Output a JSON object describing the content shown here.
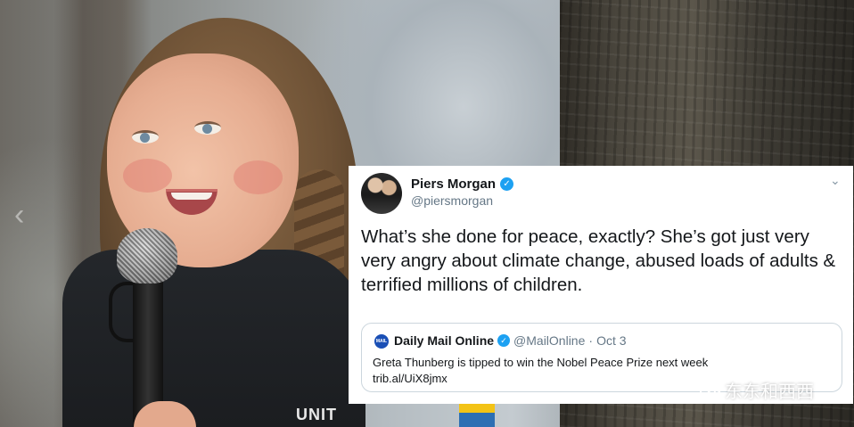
{
  "tweet": {
    "display_name": "Piers Morgan",
    "handle": "@piersmorgan",
    "text": "What’s she done for peace, exactly? She’s got just very very angry about climate change, abused loads of adults & terrified millions of children.",
    "quoted": {
      "source_name": "Daily Mail Online",
      "handle": "@MailOnline",
      "separator": "·",
      "date": "Oct 3",
      "headline": "Greta Thunberg is tipped to win the Nobel Peace Prize next week",
      "link": "trib.al/UiX8jmx"
    }
  },
  "photo": {
    "jacket_text": "UNIT"
  },
  "watermark": {
    "text": "东东和西西"
  },
  "colors": {
    "verified_blue": "#1da1f2",
    "tweet_text": "#14171a",
    "muted_text": "#657786"
  }
}
